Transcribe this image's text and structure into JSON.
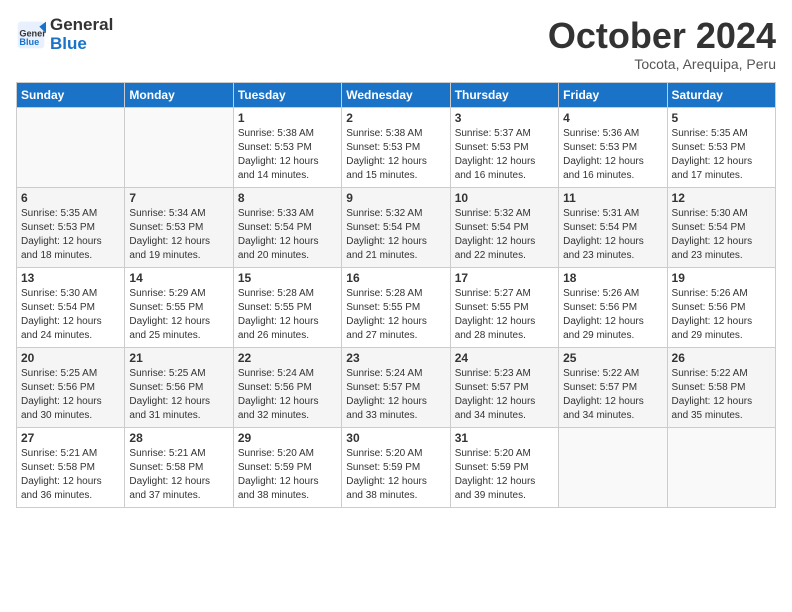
{
  "header": {
    "logo_general": "General",
    "logo_blue": "Blue",
    "month_title": "October 2024",
    "location": "Tocota, Arequipa, Peru"
  },
  "weekdays": [
    "Sunday",
    "Monday",
    "Tuesday",
    "Wednesday",
    "Thursday",
    "Friday",
    "Saturday"
  ],
  "weeks": [
    [
      {
        "day": "",
        "sunrise": "",
        "sunset": "",
        "daylight": ""
      },
      {
        "day": "",
        "sunrise": "",
        "sunset": "",
        "daylight": ""
      },
      {
        "day": "1",
        "sunrise": "Sunrise: 5:38 AM",
        "sunset": "Sunset: 5:53 PM",
        "daylight": "Daylight: 12 hours and 14 minutes."
      },
      {
        "day": "2",
        "sunrise": "Sunrise: 5:38 AM",
        "sunset": "Sunset: 5:53 PM",
        "daylight": "Daylight: 12 hours and 15 minutes."
      },
      {
        "day": "3",
        "sunrise": "Sunrise: 5:37 AM",
        "sunset": "Sunset: 5:53 PM",
        "daylight": "Daylight: 12 hours and 16 minutes."
      },
      {
        "day": "4",
        "sunrise": "Sunrise: 5:36 AM",
        "sunset": "Sunset: 5:53 PM",
        "daylight": "Daylight: 12 hours and 16 minutes."
      },
      {
        "day": "5",
        "sunrise": "Sunrise: 5:35 AM",
        "sunset": "Sunset: 5:53 PM",
        "daylight": "Daylight: 12 hours and 17 minutes."
      }
    ],
    [
      {
        "day": "6",
        "sunrise": "Sunrise: 5:35 AM",
        "sunset": "Sunset: 5:53 PM",
        "daylight": "Daylight: 12 hours and 18 minutes."
      },
      {
        "day": "7",
        "sunrise": "Sunrise: 5:34 AM",
        "sunset": "Sunset: 5:53 PM",
        "daylight": "Daylight: 12 hours and 19 minutes."
      },
      {
        "day": "8",
        "sunrise": "Sunrise: 5:33 AM",
        "sunset": "Sunset: 5:54 PM",
        "daylight": "Daylight: 12 hours and 20 minutes."
      },
      {
        "day": "9",
        "sunrise": "Sunrise: 5:32 AM",
        "sunset": "Sunset: 5:54 PM",
        "daylight": "Daylight: 12 hours and 21 minutes."
      },
      {
        "day": "10",
        "sunrise": "Sunrise: 5:32 AM",
        "sunset": "Sunset: 5:54 PM",
        "daylight": "Daylight: 12 hours and 22 minutes."
      },
      {
        "day": "11",
        "sunrise": "Sunrise: 5:31 AM",
        "sunset": "Sunset: 5:54 PM",
        "daylight": "Daylight: 12 hours and 23 minutes."
      },
      {
        "day": "12",
        "sunrise": "Sunrise: 5:30 AM",
        "sunset": "Sunset: 5:54 PM",
        "daylight": "Daylight: 12 hours and 23 minutes."
      }
    ],
    [
      {
        "day": "13",
        "sunrise": "Sunrise: 5:30 AM",
        "sunset": "Sunset: 5:54 PM",
        "daylight": "Daylight: 12 hours and 24 minutes."
      },
      {
        "day": "14",
        "sunrise": "Sunrise: 5:29 AM",
        "sunset": "Sunset: 5:55 PM",
        "daylight": "Daylight: 12 hours and 25 minutes."
      },
      {
        "day": "15",
        "sunrise": "Sunrise: 5:28 AM",
        "sunset": "Sunset: 5:55 PM",
        "daylight": "Daylight: 12 hours and 26 minutes."
      },
      {
        "day": "16",
        "sunrise": "Sunrise: 5:28 AM",
        "sunset": "Sunset: 5:55 PM",
        "daylight": "Daylight: 12 hours and 27 minutes."
      },
      {
        "day": "17",
        "sunrise": "Sunrise: 5:27 AM",
        "sunset": "Sunset: 5:55 PM",
        "daylight": "Daylight: 12 hours and 28 minutes."
      },
      {
        "day": "18",
        "sunrise": "Sunrise: 5:26 AM",
        "sunset": "Sunset: 5:56 PM",
        "daylight": "Daylight: 12 hours and 29 minutes."
      },
      {
        "day": "19",
        "sunrise": "Sunrise: 5:26 AM",
        "sunset": "Sunset: 5:56 PM",
        "daylight": "Daylight: 12 hours and 29 minutes."
      }
    ],
    [
      {
        "day": "20",
        "sunrise": "Sunrise: 5:25 AM",
        "sunset": "Sunset: 5:56 PM",
        "daylight": "Daylight: 12 hours and 30 minutes."
      },
      {
        "day": "21",
        "sunrise": "Sunrise: 5:25 AM",
        "sunset": "Sunset: 5:56 PM",
        "daylight": "Daylight: 12 hours and 31 minutes."
      },
      {
        "day": "22",
        "sunrise": "Sunrise: 5:24 AM",
        "sunset": "Sunset: 5:56 PM",
        "daylight": "Daylight: 12 hours and 32 minutes."
      },
      {
        "day": "23",
        "sunrise": "Sunrise: 5:24 AM",
        "sunset": "Sunset: 5:57 PM",
        "daylight": "Daylight: 12 hours and 33 minutes."
      },
      {
        "day": "24",
        "sunrise": "Sunrise: 5:23 AM",
        "sunset": "Sunset: 5:57 PM",
        "daylight": "Daylight: 12 hours and 34 minutes."
      },
      {
        "day": "25",
        "sunrise": "Sunrise: 5:22 AM",
        "sunset": "Sunset: 5:57 PM",
        "daylight": "Daylight: 12 hours and 34 minutes."
      },
      {
        "day": "26",
        "sunrise": "Sunrise: 5:22 AM",
        "sunset": "Sunset: 5:58 PM",
        "daylight": "Daylight: 12 hours and 35 minutes."
      }
    ],
    [
      {
        "day": "27",
        "sunrise": "Sunrise: 5:21 AM",
        "sunset": "Sunset: 5:58 PM",
        "daylight": "Daylight: 12 hours and 36 minutes."
      },
      {
        "day": "28",
        "sunrise": "Sunrise: 5:21 AM",
        "sunset": "Sunset: 5:58 PM",
        "daylight": "Daylight: 12 hours and 37 minutes."
      },
      {
        "day": "29",
        "sunrise": "Sunrise: 5:20 AM",
        "sunset": "Sunset: 5:59 PM",
        "daylight": "Daylight: 12 hours and 38 minutes."
      },
      {
        "day": "30",
        "sunrise": "Sunrise: 5:20 AM",
        "sunset": "Sunset: 5:59 PM",
        "daylight": "Daylight: 12 hours and 38 minutes."
      },
      {
        "day": "31",
        "sunrise": "Sunrise: 5:20 AM",
        "sunset": "Sunset: 5:59 PM",
        "daylight": "Daylight: 12 hours and 39 minutes."
      },
      {
        "day": "",
        "sunrise": "",
        "sunset": "",
        "daylight": ""
      },
      {
        "day": "",
        "sunrise": "",
        "sunset": "",
        "daylight": ""
      }
    ]
  ]
}
